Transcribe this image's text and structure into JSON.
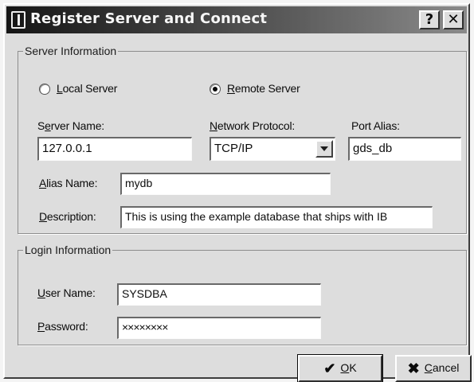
{
  "window": {
    "title": "Register Server and Connect",
    "help_glyph": "?",
    "close_glyph": "✕"
  },
  "server_info": {
    "legend": "Server Information",
    "local_radio": {
      "mnemonic": "L",
      "rest": "ocal Server",
      "checked": false
    },
    "remote_radio": {
      "mnemonic": "R",
      "rest": "emote Server",
      "checked": true
    },
    "server_name": {
      "pre": "S",
      "mnemonic": "e",
      "rest": "rver Name:",
      "value": "127.0.0.1"
    },
    "network_protocol": {
      "mnemonic": "N",
      "rest": "etwork Protocol:",
      "value": "TCP/IP"
    },
    "port_alias": {
      "label": "Port Alias:",
      "value": "gds_db"
    },
    "alias_name": {
      "mnemonic": "A",
      "rest": "lias Name:",
      "value": "mydb"
    },
    "description": {
      "mnemonic": "D",
      "rest": "escription:",
      "value": "This is using the example database that ships with IB"
    }
  },
  "login_info": {
    "legend": "Login Information",
    "user_name": {
      "mnemonic": "U",
      "rest": "ser Name:",
      "value": "SYSDBA"
    },
    "password": {
      "mnemonic": "P",
      "rest": "assword:",
      "value": "××××××××"
    }
  },
  "buttons": {
    "ok": {
      "icon": "check-icon",
      "glyph": "✔",
      "mnemonic": "O",
      "rest": "K"
    },
    "cancel": {
      "icon": "cross-icon",
      "glyph": "✖",
      "mnemonic": "C",
      "rest": "ancel"
    }
  }
}
